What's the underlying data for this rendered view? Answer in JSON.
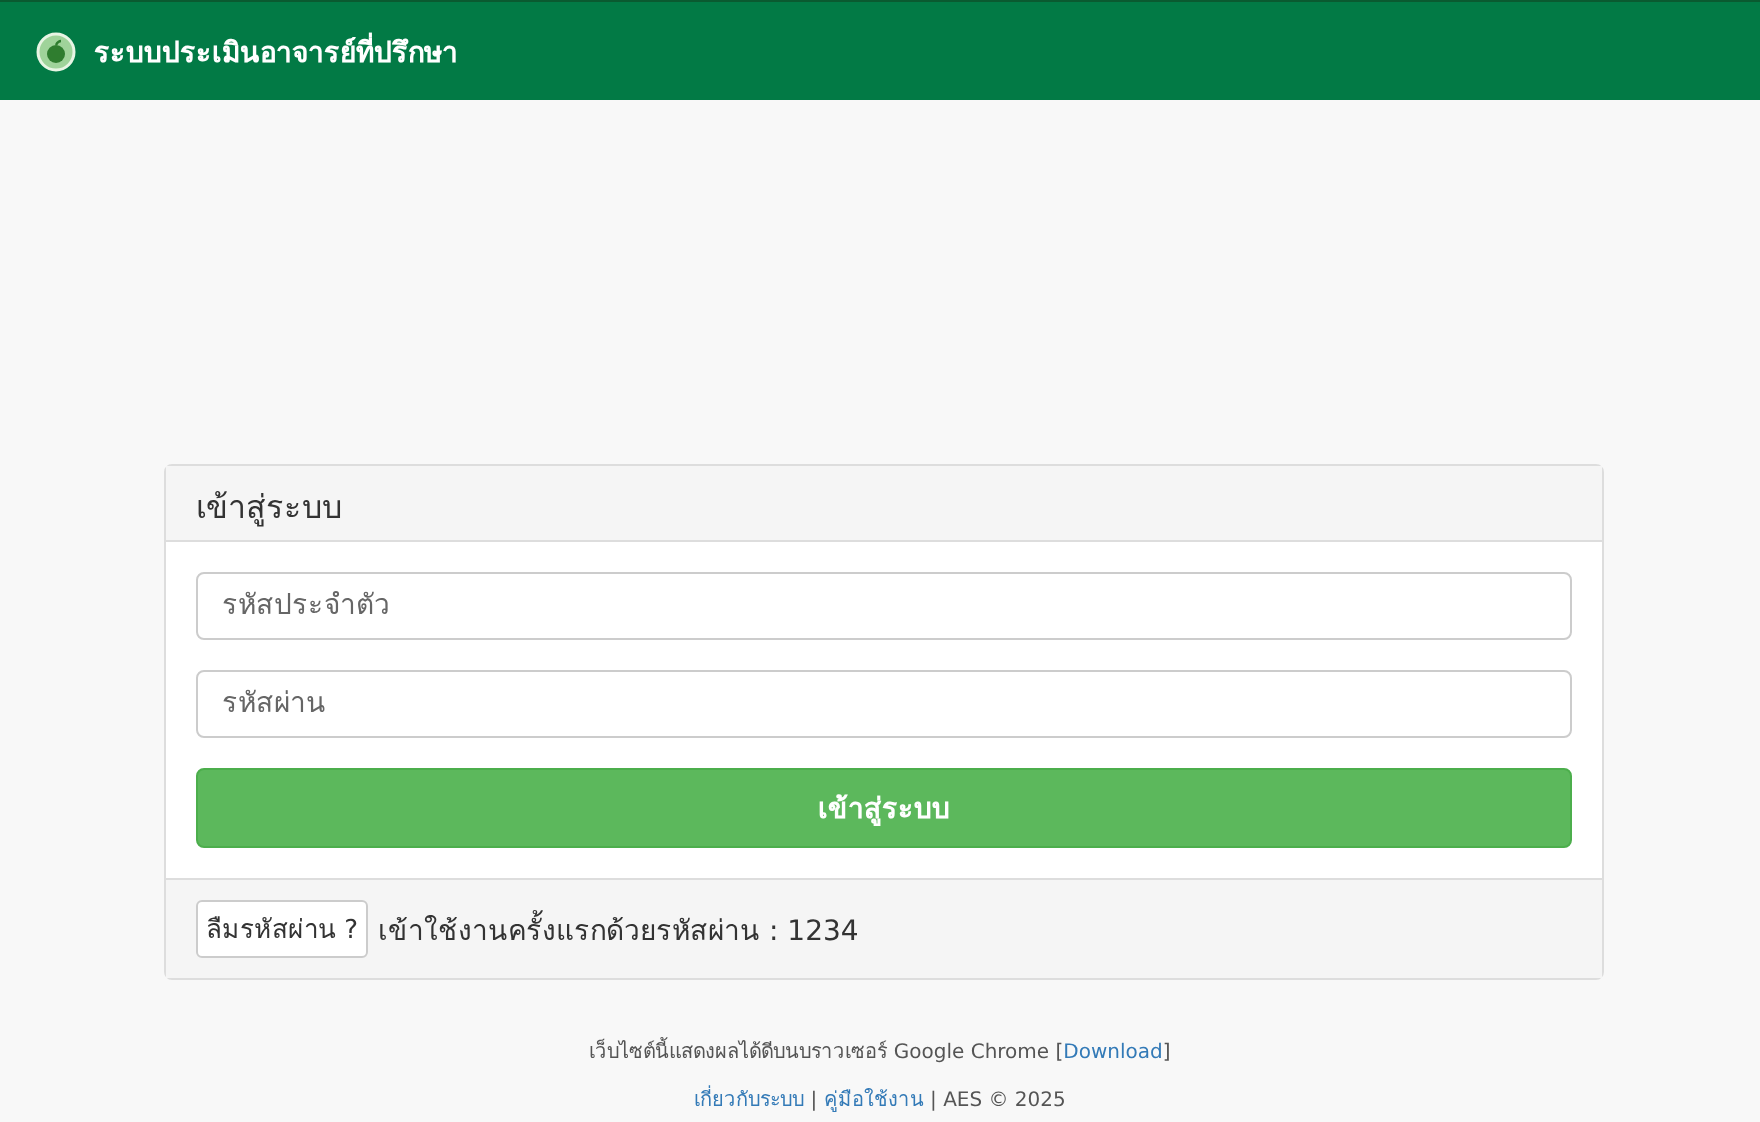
{
  "navbar": {
    "title": "ระบบประเมินอาจารย์ที่ปรึกษา"
  },
  "login_panel": {
    "heading": "เข้าสู่ระบบ",
    "fields": [
      {
        "placeholder": "รหัสประจำตัว"
      },
      {
        "placeholder": "รหัสผ่าน"
      }
    ],
    "submit_button": "เข้าสู่ระบบ",
    "forgot_button": "ลืมรหัสผ่าน ?",
    "hint": "เข้าใช้งานครั้งแรกด้วยรหัสผ่าน : 1234"
  },
  "footer": {
    "lines": [
      [
        {
          "kind": "text",
          "text": "เว็บไซต์นี้แสดงผลได้ดีบนบราวเซอร์ Google Chrome ["
        },
        {
          "kind": "link",
          "text": "Download"
        },
        {
          "kind": "text",
          "text": "]"
        }
      ],
      [
        {
          "kind": "link",
          "text": "เกี่ยวกับระบบ"
        },
        {
          "kind": "text",
          "text": " | "
        },
        {
          "kind": "link",
          "text": "คู่มือใช้งาน"
        },
        {
          "kind": "text",
          "text": " | AES © 2025"
        }
      ]
    ]
  }
}
